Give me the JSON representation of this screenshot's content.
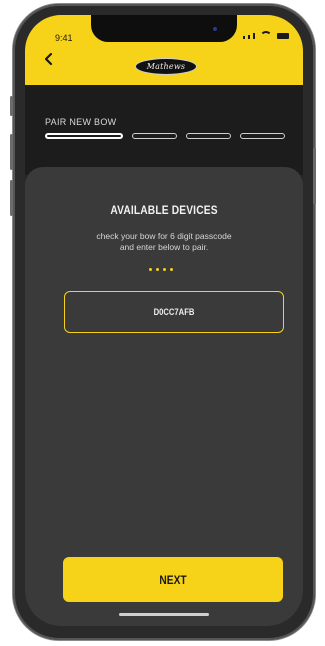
{
  "status_bar": {
    "time": "9:41"
  },
  "header": {
    "logo_text": "Mathews",
    "title": "PAIR NEW BOW"
  },
  "progress": {
    "total_steps": 4,
    "current_step": 1
  },
  "card": {
    "title": "AVAILABLE DEVICES",
    "instructions": "check your bow for 6 digit passcode and enter below to pair.",
    "code_value": "D0CC7AFB"
  },
  "footer": {
    "next_label": "NEXT"
  },
  "colors": {
    "accent": "#F6D219",
    "background": "#262626",
    "card": "#3A3A3A"
  },
  "icons": {
    "back": "chevron-left-icon",
    "signal": "cellular-signal-icon",
    "wifi": "wifi-icon",
    "battery": "battery-icon"
  }
}
